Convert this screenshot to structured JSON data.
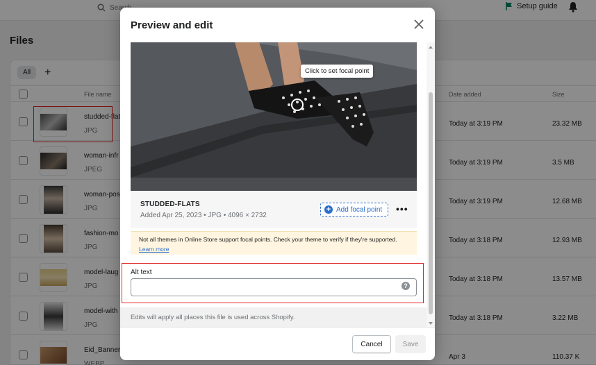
{
  "topbar": {
    "search_placeholder": "Search",
    "setup_guide": "Setup guide"
  },
  "page": {
    "title": "Files",
    "tab_all": "All",
    "columns": {
      "file_name": "File name",
      "date_added": "Date added",
      "size": "Size"
    }
  },
  "files": [
    {
      "name": "studded-flats",
      "type": "JPG",
      "date": "Today at 3:19 PM",
      "size": "23.32 MB"
    },
    {
      "name": "woman-infr",
      "type": "JPEG",
      "date": "Today at 3:19 PM",
      "size": "3.5 MB"
    },
    {
      "name": "woman-pos",
      "type": "JPG",
      "date": "Today at 3:19 PM",
      "size": "12.68 MB"
    },
    {
      "name": "fashion-mo",
      "type": "JPG",
      "date": "Today at 3:18 PM",
      "size": "12.93 MB"
    },
    {
      "name": "model-laug",
      "type": "JPG",
      "date": "Today at 3:18 PM",
      "size": "13.57 MB"
    },
    {
      "name": "model-with",
      "type": "JPG",
      "date": "Today at 3:18 PM",
      "size": "3.22 MB"
    },
    {
      "name": "Eid_Banner",
      "type": "WEBP",
      "date": "Apr 3",
      "size": "110.37 K"
    }
  ],
  "modal": {
    "title": "Preview and edit",
    "tooltip": "Click to set focal point",
    "file_name": "STUDDED-FLATS",
    "file_meta": "Added Apr 25, 2023 • JPG • 4096 × 2732",
    "add_focal_point": "Add focal point",
    "more": "•••",
    "banner_text": "Not all themes in Online Store support focal points. Check your theme to verify if they're supported.",
    "banner_link": "Learn more",
    "alt_text_label": "Alt text",
    "alt_text_value": "",
    "help": "?",
    "edits_note": "Edits will apply all places this file is used across Shopify.",
    "cancel": "Cancel",
    "save": "Save"
  },
  "colors": {
    "accent": "#2c6ecb",
    "highlight": "#e02424",
    "banner_bg": "#fff5e0"
  },
  "icons": [
    "search-icon",
    "flag-icon",
    "bell-icon",
    "close-icon",
    "plus-circle-icon",
    "help-icon"
  ]
}
